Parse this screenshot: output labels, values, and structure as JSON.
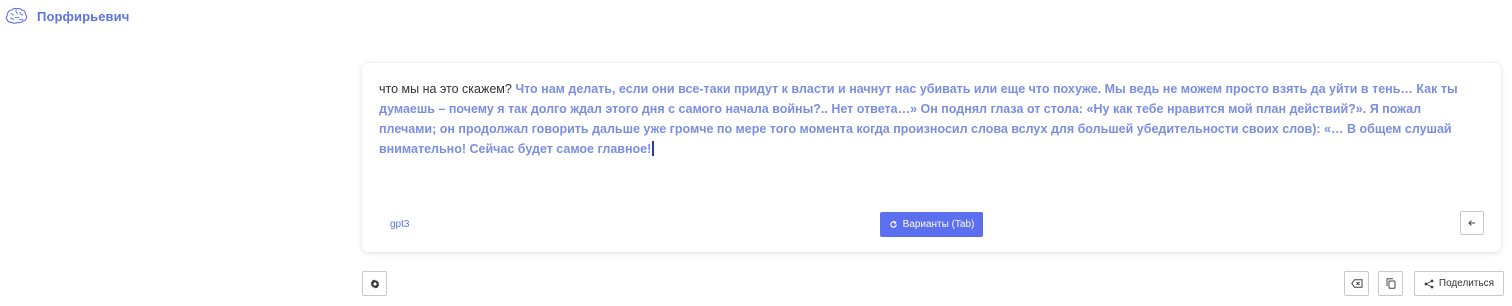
{
  "app": {
    "name": "Порфирьевич"
  },
  "editor": {
    "user_text": "что мы на это скажем?",
    "generated_text": "Что нам делать, если они все-таки придут к власти и начнут нас убивать или еще что похуже. Мы ведь не можем просто взять да уйти в тень… Как ты думаешь – почему я так долго ждал этого дня с самого начала войны?.. Нет ответа…» Он поднял глаза от стола: «Ну как тебе нравится мой план действий?». Я пожал плечами; он продолжал говорить дальше уже громче по мере того момента когда произносил слова вслух для большей убедительности своих слов): «… В общем слушай внимательно! Сейчас будет самое главное!",
    "model": "gpt3",
    "variants_label": "Варианты (Tab)"
  },
  "toolbar": {
    "share_label": "Поделиться"
  },
  "icons": {
    "logo": "brain-logo",
    "variants": "refresh-icon",
    "back": "arrow-left-icon",
    "settings": "gear-icon",
    "clear": "backspace-icon",
    "copy": "copy-icon",
    "share": "share-icon"
  },
  "colors": {
    "accent": "#5b6ff0",
    "generated_text": "#7a8fe3",
    "brand_text": "#5a74e6"
  }
}
